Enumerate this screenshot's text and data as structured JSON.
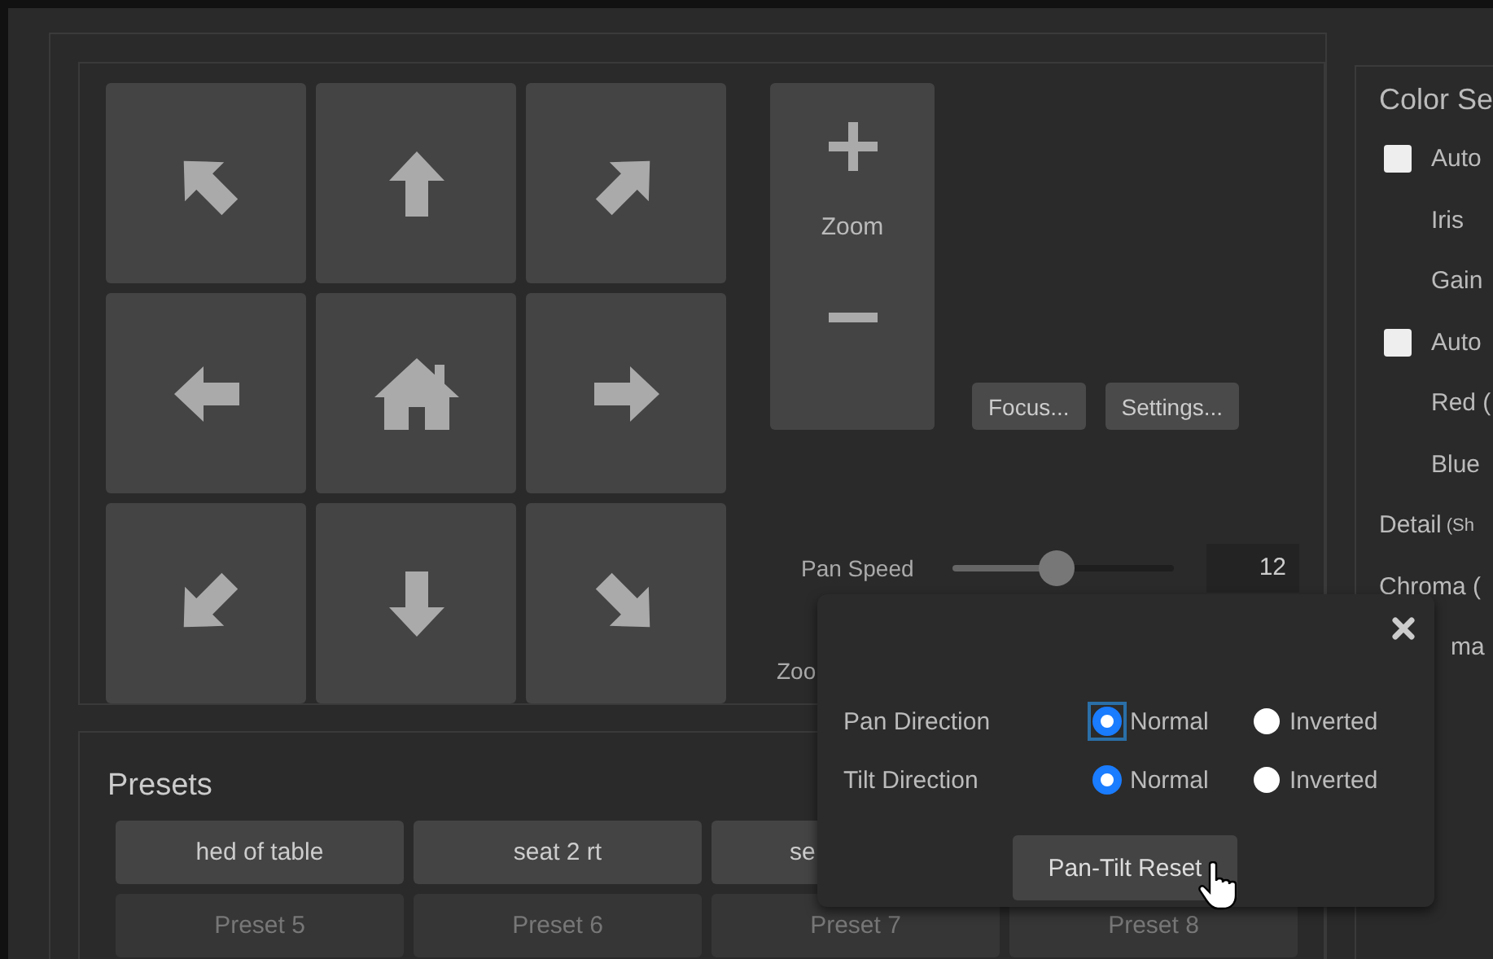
{
  "pad": [
    {
      "kind": "nw"
    },
    {
      "kind": "n"
    },
    {
      "kind": "ne"
    },
    {
      "kind": "w"
    },
    {
      "kind": "home"
    },
    {
      "kind": "e"
    },
    {
      "kind": "sw"
    },
    {
      "kind": "s"
    },
    {
      "kind": "se"
    }
  ],
  "zoom": {
    "label": "Zoom"
  },
  "buttons": [
    "Focus...",
    "Settings..."
  ],
  "pan_speed": {
    "label": "Pan Speed",
    "level": 0.47,
    "value": "12"
  },
  "zoom_speed": {
    "label": "Zoo"
  },
  "presets": {
    "title": "Presets",
    "rows": [
      [
        {
          "label": "hed of table",
          "saved": true
        },
        {
          "label": "seat 2 rt",
          "saved": true
        },
        {
          "label": "se",
          "saved": true
        }
      ],
      [
        {
          "label": "Preset 5",
          "saved": false
        },
        {
          "label": "Preset 6",
          "saved": false
        },
        {
          "label": "Preset 7",
          "saved": false
        },
        {
          "label": "Preset 8",
          "saved": false
        }
      ]
    ]
  },
  "color": {
    "title": "Color Se",
    "rows": [
      {
        "kind": "check",
        "label": "Auto",
        "checked": false
      },
      {
        "kind": "sub",
        "label": "Iris"
      },
      {
        "kind": "sub",
        "label": "Gain"
      },
      {
        "kind": "check",
        "label": "Auto",
        "checked": false
      },
      {
        "kind": "sub",
        "label": "Red ("
      },
      {
        "kind": "sub",
        "label": "Blue"
      },
      {
        "kind": "plain",
        "label": "Detail",
        "note": "(Sh"
      },
      {
        "kind": "plain",
        "label": "Chroma ("
      },
      {
        "kind": "tail",
        "label": "ma"
      }
    ]
  },
  "popup": {
    "rows": [
      {
        "label": "Pan Direction",
        "options": [
          {
            "label": "Normal",
            "selected": true,
            "focused": true
          },
          {
            "label": "Inverted",
            "selected": false,
            "focused": false
          }
        ]
      },
      {
        "label": "Tilt Direction",
        "options": [
          {
            "label": "Normal",
            "selected": true,
            "focused": false
          },
          {
            "label": "Inverted",
            "selected": false,
            "focused": false
          }
        ]
      }
    ],
    "reset": "Pan-Tilt Reset"
  }
}
